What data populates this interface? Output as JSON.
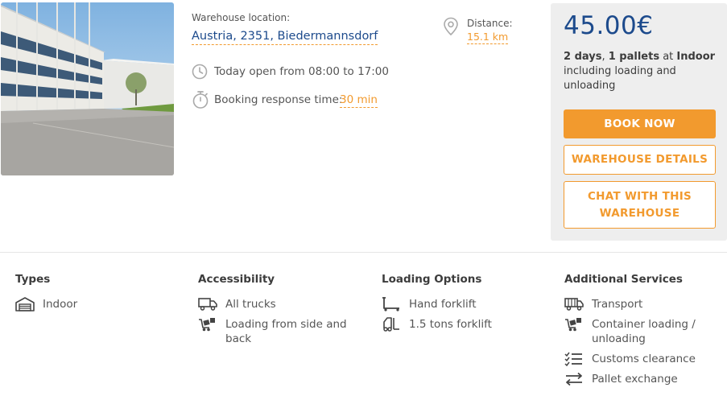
{
  "listing": {
    "location_label": "Warehouse location:",
    "location_value": "Austria, 2351, Biedermannsdorf",
    "distance_label": "Distance:",
    "distance_value": "15.1 km",
    "opening_hours": "Today open from 08:00 to 17:00",
    "response_label": "Booking response time:",
    "response_value": "30 min"
  },
  "booking": {
    "price": "45.00€",
    "days": "2 days",
    "sep1": ", ",
    "pallets": "1 pallets",
    "at_text": " at ",
    "type": "Indoor",
    "including_text": " including loading and unloading",
    "book_label": "BOOK NOW",
    "details_label": "WAREHOUSE DETAILS",
    "chat_label": "CHAT WITH THIS WAREHOUSE"
  },
  "features": {
    "types": {
      "title": "Types",
      "items": [
        {
          "label": "Indoor",
          "icon": "warehouse-icon"
        }
      ]
    },
    "accessibility": {
      "title": "Accessibility",
      "items": [
        {
          "label": "All trucks",
          "icon": "truck-icon"
        },
        {
          "label": "Loading from side and back",
          "icon": "side-loading-icon"
        }
      ]
    },
    "loading": {
      "title": "Loading Options",
      "items": [
        {
          "label": "Hand forklift",
          "icon": "hand-forklift-icon"
        },
        {
          "label": "1.5 tons forklift",
          "icon": "forklift-icon"
        }
      ]
    },
    "services": {
      "title": "Additional Services",
      "items": [
        {
          "label": "Transport",
          "icon": "transport-icon"
        },
        {
          "label": "Container loading / unloading",
          "icon": "container-loading-icon"
        },
        {
          "label": "Customs clearance",
          "icon": "checklist-icon"
        },
        {
          "label": "Pallet exchange",
          "icon": "exchange-icon"
        }
      ]
    }
  },
  "colors": {
    "accent": "#f29a2e",
    "primary": "#1c4a8c",
    "panel": "#eeeeee"
  }
}
